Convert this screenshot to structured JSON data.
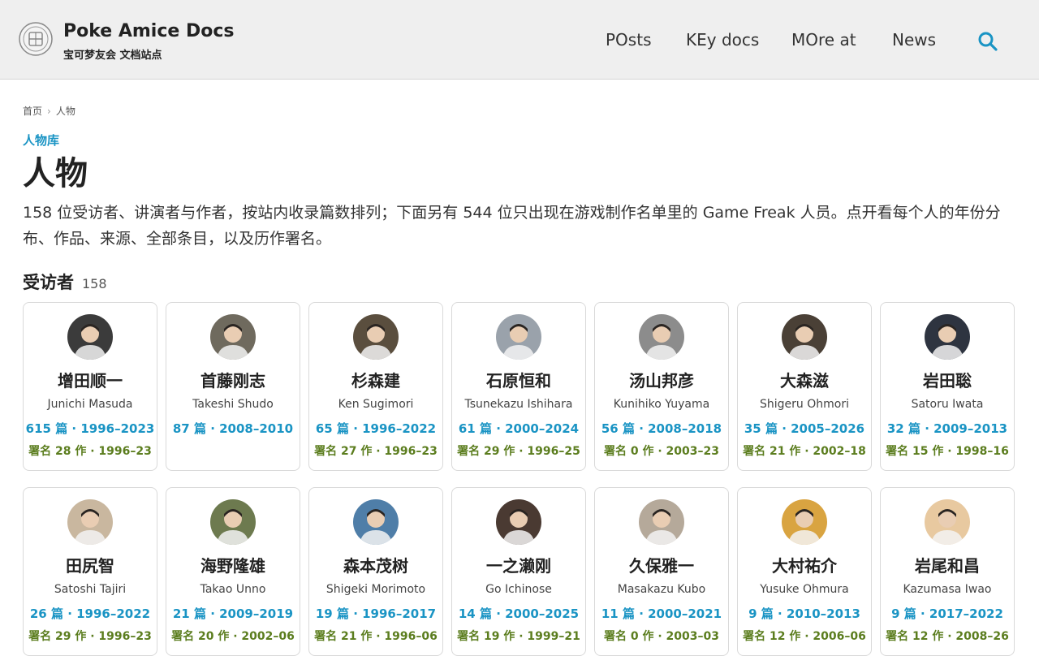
{
  "header": {
    "title": "Poke Amice Docs",
    "subtitle": "宝可梦友会 文档站点",
    "nav": [
      {
        "label": "POsts",
        "name": "nav-posts"
      },
      {
        "label": "KEy docs",
        "name": "nav-key-docs"
      },
      {
        "label": "MOre at",
        "name": "nav-more-at"
      },
      {
        "label": "News",
        "name": "nav-news"
      }
    ],
    "search_icon": "search-icon",
    "accent": "#1a94c4"
  },
  "breadcrumb": {
    "home": "首页",
    "sep": "›",
    "current": "人物"
  },
  "eyebrow": "人物库",
  "page_title": "人物",
  "intro": "158 位受访者、讲演者与作者，按站内收录篇数排列；下面另有 544 位只出现在游戏制作名单里的 Game Freak 人员。点开看每个人的年份分布、作品、来源、全部条目，以及历作署名。",
  "section": {
    "title": "受访者",
    "count": "158"
  },
  "people": [
    {
      "zh": "增田顺一",
      "en": "Junichi Masuda",
      "stats": "615 篇 · 1996–2023",
      "sign": "署名 28 作 · 1996–23",
      "color": "#3b3b3b"
    },
    {
      "zh": "首藤刚志",
      "en": "Takeshi Shudo",
      "stats": "87 篇 · 2008–2010",
      "sign": "",
      "color": "#6f6a5e"
    },
    {
      "zh": "杉森建",
      "en": "Ken Sugimori",
      "stats": "65 篇 · 1996–2022",
      "sign": "署名 27 作 · 1996–23",
      "color": "#5a4e3e"
    },
    {
      "zh": "石原恒和",
      "en": "Tsunekazu Ishihara",
      "stats": "61 篇 · 2000–2024",
      "sign": "署名 29 作 · 1996–25",
      "color": "#9aa2ab"
    },
    {
      "zh": "汤山邦彦",
      "en": "Kunihiko Yuyama",
      "stats": "56 篇 · 2008–2018",
      "sign": "署名 0 作 · 2003–23",
      "color": "#8c8c8c"
    },
    {
      "zh": "大森滋",
      "en": "Shigeru Ohmori",
      "stats": "35 篇 · 2005–2026",
      "sign": "署名 21 作 · 2002–18",
      "color": "#4a4036"
    },
    {
      "zh": "岩田聡",
      "en": "Satoru Iwata",
      "stats": "32 篇 · 2009–2013",
      "sign": "署名 15 作 · 1998–16",
      "color": "#2e3440"
    },
    {
      "zh": "田尻智",
      "en": "Satoshi Tajiri",
      "stats": "26 篇 · 1996–2022",
      "sign": "署名 29 作 · 1996–23",
      "color": "#c9b79f"
    },
    {
      "zh": "海野隆雄",
      "en": "Takao Unno",
      "stats": "21 篇 · 2009–2019",
      "sign": "署名 20 作 · 2002–06",
      "color": "#6d7a4f"
    },
    {
      "zh": "森本茂树",
      "en": "Shigeki Morimoto",
      "stats": "19 篇 · 1996–2017",
      "sign": "署名 21 作 · 1996–06",
      "color": "#4f7ea8"
    },
    {
      "zh": "一之濑刚",
      "en": "Go Ichinose",
      "stats": "14 篇 · 2000–2025",
      "sign": "署名 19 作 · 1999–21",
      "color": "#4a3a32"
    },
    {
      "zh": "久保雅一",
      "en": "Masakazu Kubo",
      "stats": "11 篇 · 2000–2021",
      "sign": "署名 0 作 · 2003–03",
      "color": "#b5a99a"
    },
    {
      "zh": "大村祐介",
      "en": "Yusuke Ohmura",
      "stats": "9 篇 · 2010–2013",
      "sign": "署名 12 作 · 2006–06",
      "color": "#d9a441"
    },
    {
      "zh": "岩尾和昌",
      "en": "Kazumasa Iwao",
      "stats": "9 篇 · 2017–2022",
      "sign": "署名 12 作 · 2008–26",
      "color": "#e8c9a0"
    }
  ]
}
